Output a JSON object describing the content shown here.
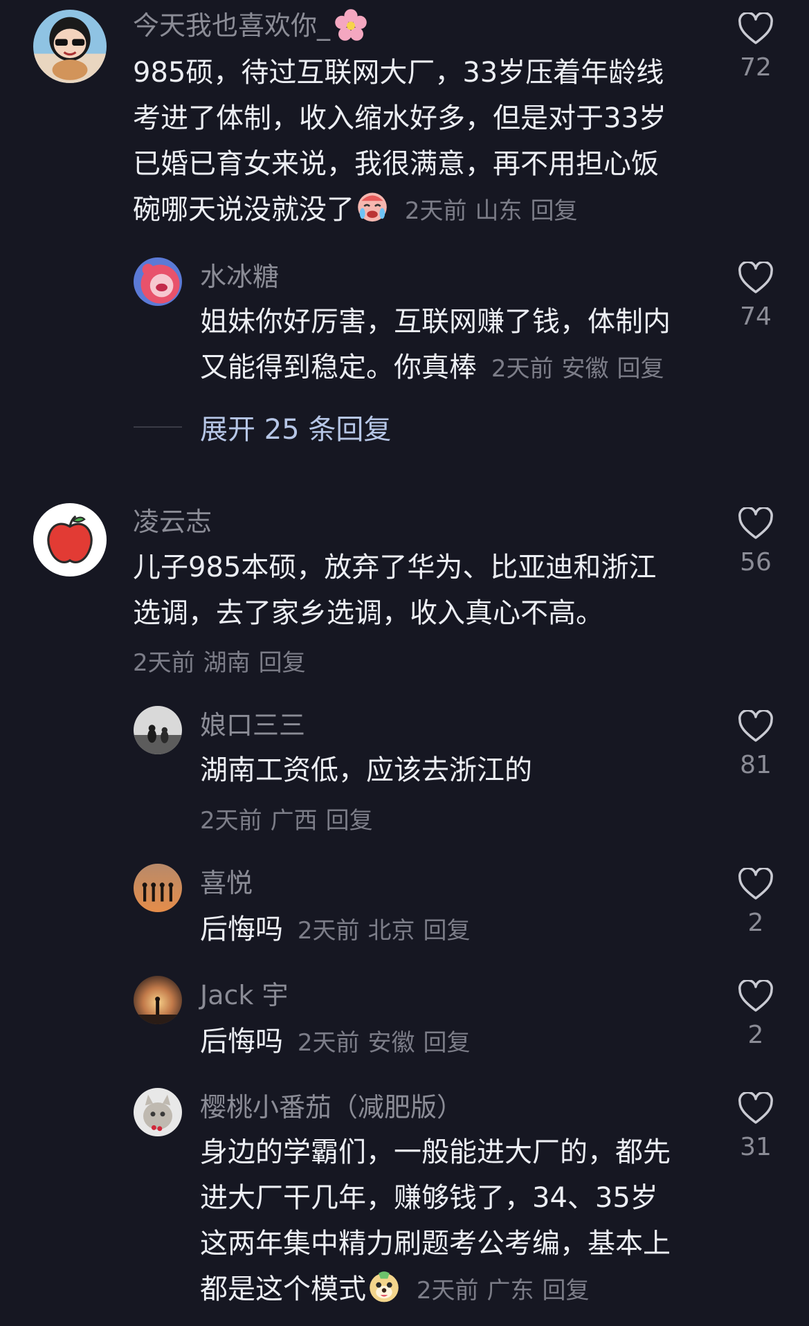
{
  "comments": [
    {
      "username": "今天我也喜欢你_",
      "lines": [
        "985硕，待过互联网大厂，33岁压着年龄线",
        "考进了体制，收入缩水好多，但是对于33岁",
        "已婚已育女来说，我很满意，再不用担心饭",
        "碗哪天说没就没了"
      ],
      "time": "2天前",
      "location": "山东",
      "reply_label": "回复",
      "likes": "72",
      "avatar_icon": "girl-sunglasses-avatar",
      "name_emoji": "cherry-blossom-emoji",
      "end_emoji": "crying-face-emoji"
    },
    {
      "username": "水冰糖",
      "lines": [
        "姐妹你好厉害，互联网赚了钱，体制内",
        "又能得到稳定。你真棒"
      ],
      "time": "2天前",
      "location": "安徽",
      "reply_label": "回复",
      "likes": "74",
      "avatar_icon": "pink-bear-avatar"
    },
    {
      "username": "凌云志",
      "lines": [
        "儿子985本硕，放弃了华为、比亚迪和浙江",
        "选调，去了家乡选调，收入真心不高。"
      ],
      "time": "2天前",
      "location": "湖南",
      "reply_label": "回复",
      "likes": "56",
      "avatar_icon": "apple-avatar"
    },
    {
      "username": "娘口三三",
      "lines": [
        "湖南工资低，应该去浙江的"
      ],
      "time": "2天前",
      "location": "广西",
      "reply_label": "回复",
      "likes": "81",
      "avatar_icon": "cats-avatar"
    },
    {
      "username": "喜悦",
      "lines": [
        "后悔吗"
      ],
      "time": "2天前",
      "location": "北京",
      "reply_label": "回复",
      "likes": "2",
      "avatar_icon": "silhouettes-sunset-avatar"
    },
    {
      "username": "Jack 宇",
      "lines": [
        "后悔吗"
      ],
      "time": "2天前",
      "location": "安徽",
      "reply_label": "回复",
      "likes": "2",
      "avatar_icon": "sunset-figure-avatar"
    },
    {
      "username": "樱桃小番茄（减肥版）",
      "lines": [
        "身边的学霸们，一般能进大厂的，都先",
        "进大厂干几年，赚够钱了，34、35岁",
        "这两年集中精力刷题考公考编，基本上",
        "都是这个模式"
      ],
      "time": "2天前",
      "location": "广东",
      "reply_label": "回复",
      "likes": "31",
      "avatar_icon": "cat-avatar",
      "end_emoji": "puppy-face-emoji"
    }
  ],
  "expand_replies": "展开 25 条回复",
  "colors": {
    "background": "#161722",
    "text": "#eceef3",
    "muted": "#8b8c96",
    "link": "#b6c6e6"
  }
}
